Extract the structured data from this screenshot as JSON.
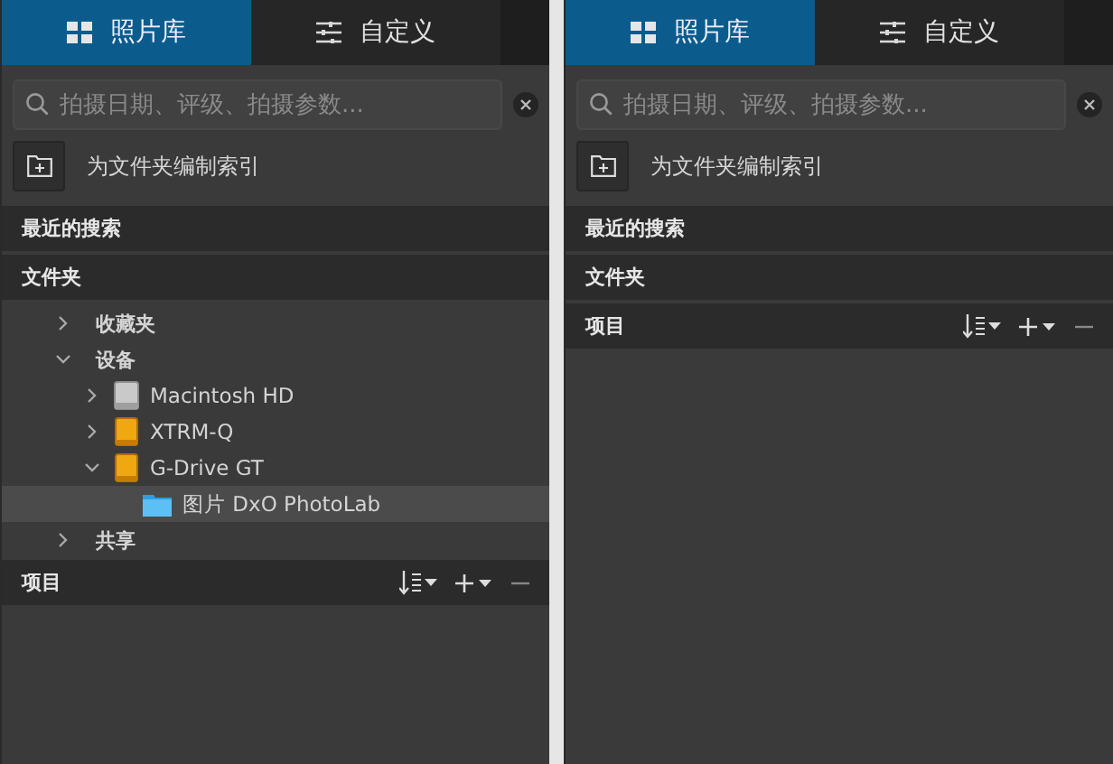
{
  "panels": [
    {
      "tabs": [
        {
          "label": "照片库",
          "selected": true
        },
        {
          "label": "自定义",
          "selected": false
        }
      ],
      "search": {
        "placeholder": "拍摄日期、评级、拍摄参数..."
      },
      "index_button": {
        "label": "为文件夹编制索引"
      },
      "recent_searches": {
        "title": "最近的搜索"
      },
      "folders": {
        "title": "文件夹",
        "tree": [
          {
            "label": "收藏夹",
            "expanded": false,
            "selected": false
          },
          {
            "label": "设备",
            "expanded": true,
            "selected": false,
            "children": [
              {
                "label": "Macintosh HD",
                "kind": "internal_drive",
                "expanded": false,
                "selected": false
              },
              {
                "label": "XTRM-Q",
                "kind": "external_drive",
                "expanded": false,
                "selected": false
              },
              {
                "label": "G-Drive GT",
                "kind": "external_drive",
                "expanded": true,
                "selected": false,
                "children": [
                  {
                    "label": "图片 DxO PhotoLab",
                    "kind": "folder",
                    "selected": true
                  }
                ]
              }
            ]
          },
          {
            "label": "共享",
            "expanded": false,
            "selected": false
          }
        ]
      },
      "items": {
        "title": "项目"
      }
    },
    {
      "tabs": [
        {
          "label": "照片库",
          "selected": true
        },
        {
          "label": "自定义",
          "selected": false
        }
      ],
      "search": {
        "placeholder": "拍摄日期、评级、拍摄参数..."
      },
      "index_button": {
        "label": "为文件夹编制索引"
      },
      "recent_searches": {
        "title": "最近的搜索"
      },
      "folders": {
        "title": "文件夹"
      },
      "items": {
        "title": "项目"
      }
    }
  ]
}
